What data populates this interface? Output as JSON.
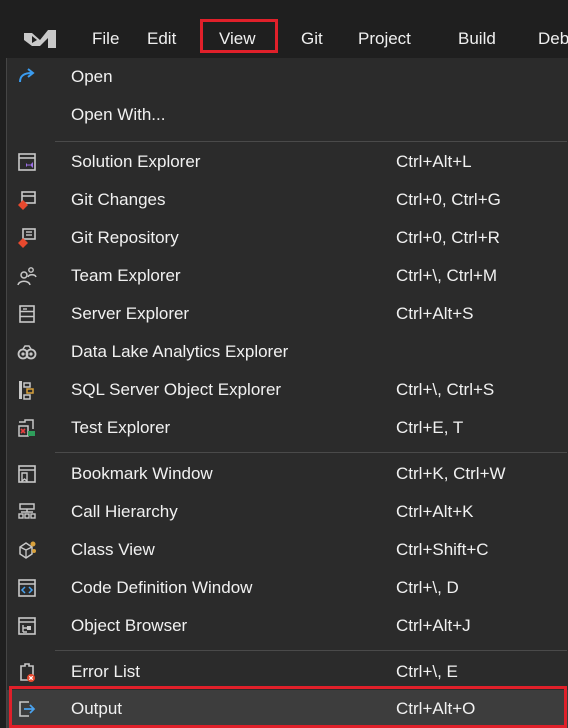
{
  "menubar": {
    "logo_icon": "visual-studio-logo-icon",
    "items": [
      {
        "label": "File"
      },
      {
        "label": "Edit"
      },
      {
        "label": "View"
      },
      {
        "label": "Git"
      },
      {
        "label": "Project"
      },
      {
        "label": "Build"
      },
      {
        "label": "Deb"
      }
    ],
    "highlight_color": "#e0202a"
  },
  "view_menu": {
    "items": [
      {
        "label": "Open",
        "shortcut": "",
        "icon": "open-arrow-icon"
      },
      {
        "label": "Open With...",
        "shortcut": "",
        "icon": ""
      },
      {
        "label": "Solution Explorer",
        "shortcut": "Ctrl+Alt+L",
        "icon": "solution-explorer-icon"
      },
      {
        "label": "Git Changes",
        "shortcut": "Ctrl+0, Ctrl+G",
        "icon": "git-changes-icon"
      },
      {
        "label": "Git Repository",
        "shortcut": "Ctrl+0, Ctrl+R",
        "icon": "git-repository-icon"
      },
      {
        "label": "Team Explorer",
        "shortcut": "Ctrl+\\, Ctrl+M",
        "icon": "team-explorer-icon"
      },
      {
        "label": "Server Explorer",
        "shortcut": "Ctrl+Alt+S",
        "icon": "server-explorer-icon"
      },
      {
        "label": "Data Lake Analytics Explorer",
        "shortcut": "",
        "icon": "data-lake-icon"
      },
      {
        "label": "SQL Server Object Explorer",
        "shortcut": "Ctrl+\\, Ctrl+S",
        "icon": "sql-server-icon"
      },
      {
        "label": "Test Explorer",
        "shortcut": "Ctrl+E, T",
        "icon": "test-explorer-icon"
      },
      {
        "label": "Bookmark Window",
        "shortcut": "Ctrl+K, Ctrl+W",
        "icon": "bookmark-window-icon"
      },
      {
        "label": "Call Hierarchy",
        "shortcut": "Ctrl+Alt+K",
        "icon": "call-hierarchy-icon"
      },
      {
        "label": "Class View",
        "shortcut": "Ctrl+Shift+C",
        "icon": "class-view-icon"
      },
      {
        "label": "Code Definition Window",
        "shortcut": "Ctrl+\\, D",
        "icon": "code-definition-icon"
      },
      {
        "label": "Object Browser",
        "shortcut": "Ctrl+Alt+J",
        "icon": "object-browser-icon"
      },
      {
        "label": "Error List",
        "shortcut": "Ctrl+\\, E",
        "icon": "error-list-icon"
      },
      {
        "label": "Output",
        "shortcut": "Ctrl+Alt+O",
        "icon": "output-icon"
      }
    ],
    "selected_item": "Output"
  }
}
